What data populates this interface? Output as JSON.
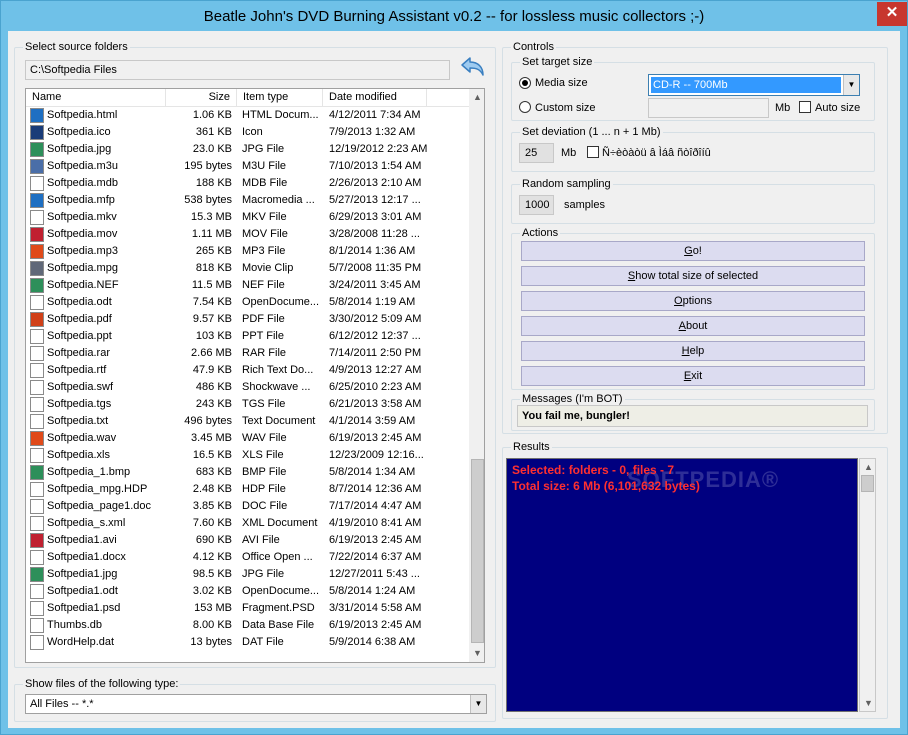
{
  "window": {
    "title": "Beatle John's DVD Burning Assistant v0.2 -- for lossless music collectors ;-)",
    "close_glyph": "✕"
  },
  "source": {
    "group_label": "Select source folders",
    "path": "C:\\Softpedia Files",
    "columns": {
      "name": "Name",
      "size": "Size",
      "type": "Item type",
      "date": "Date modified"
    },
    "files": [
      {
        "name": "Softpedia.html",
        "size": "1.06 KB",
        "type": "HTML Docum...",
        "date": "4/12/2011 7:34 AM",
        "icon": "html-icon",
        "color": "#1e6fc2"
      },
      {
        "name": "Softpedia.ico",
        "size": "361 KB",
        "type": "Icon",
        "date": "7/9/2013 1:32 AM",
        "icon": "ico-icon",
        "color": "#1a3c78"
      },
      {
        "name": "Softpedia.jpg",
        "size": "23.0 KB",
        "type": "JPG File",
        "date": "12/19/2012 2:23 AM",
        "icon": "image-icon",
        "color": "#2d8f5a"
      },
      {
        "name": "Softpedia.m3u",
        "size": "195 bytes",
        "type": "M3U File",
        "date": "7/10/2013 1:54 AM",
        "icon": "music-note-icon",
        "color": "#4a6ea8"
      },
      {
        "name": "Softpedia.mdb",
        "size": "188 KB",
        "type": "MDB File",
        "date": "2/26/2013 2:10 AM",
        "icon": "file-icon",
        "color": "#ffffff"
      },
      {
        "name": "Softpedia.mfp",
        "size": "538 bytes",
        "type": "Macromedia ...",
        "date": "5/27/2013 12:17 ...",
        "icon": "html-icon",
        "color": "#1e6fc2"
      },
      {
        "name": "Softpedia.mkv",
        "size": "15.3 MB",
        "type": "MKV File",
        "date": "6/29/2013 3:01 AM",
        "icon": "file-icon",
        "color": "#ffffff"
      },
      {
        "name": "Softpedia.mov",
        "size": "1.11 MB",
        "type": "MOV File",
        "date": "3/28/2008 11:28 ...",
        "icon": "video-icon",
        "color": "#c02030"
      },
      {
        "name": "Softpedia.mp3",
        "size": "265 KB",
        "type": "MP3 File",
        "date": "8/1/2014 1:36 AM",
        "icon": "headphones-icon",
        "color": "#e04a1a"
      },
      {
        "name": "Softpedia.mpg",
        "size": "818 KB",
        "type": "Movie Clip",
        "date": "5/7/2008 11:35 PM",
        "icon": "film-icon",
        "color": "#606878"
      },
      {
        "name": "Softpedia.NEF",
        "size": "11.5 MB",
        "type": "NEF File",
        "date": "3/24/2011 3:45 AM",
        "icon": "image-icon",
        "color": "#2d8f5a"
      },
      {
        "name": "Softpedia.odt",
        "size": "7.54 KB",
        "type": "OpenDocume...",
        "date": "5/8/2014 1:19 AM",
        "icon": "document-icon",
        "color": "#ffffff"
      },
      {
        "name": "Softpedia.pdf",
        "size": "9.57 KB",
        "type": "PDF File",
        "date": "3/30/2012 5:09 AM",
        "icon": "pdf-icon",
        "color": "#d04018"
      },
      {
        "name": "Softpedia.ppt",
        "size": "103 KB",
        "type": "PPT File",
        "date": "6/12/2012 12:37 ...",
        "icon": "file-icon",
        "color": "#ffffff"
      },
      {
        "name": "Softpedia.rar",
        "size": "2.66 MB",
        "type": "RAR File",
        "date": "7/14/2011 2:50 PM",
        "icon": "file-icon",
        "color": "#ffffff"
      },
      {
        "name": "Softpedia.rtf",
        "size": "47.9 KB",
        "type": "Rich Text Do...",
        "date": "4/9/2013 12:27 AM",
        "icon": "document-icon",
        "color": "#ffffff"
      },
      {
        "name": "Softpedia.swf",
        "size": "486 KB",
        "type": "Shockwave ...",
        "date": "6/25/2010 2:23 AM",
        "icon": "file-icon",
        "color": "#ffffff"
      },
      {
        "name": "Softpedia.tgs",
        "size": "243 KB",
        "type": "TGS File",
        "date": "6/21/2013 3:58 AM",
        "icon": "file-icon",
        "color": "#ffffff"
      },
      {
        "name": "Softpedia.txt",
        "size": "496 bytes",
        "type": "Text Document",
        "date": "4/1/2014 3:59 AM",
        "icon": "document-icon",
        "color": "#ffffff"
      },
      {
        "name": "Softpedia.wav",
        "size": "3.45 MB",
        "type": "WAV File",
        "date": "6/19/2013 2:45 AM",
        "icon": "headphones-icon",
        "color": "#e04a1a"
      },
      {
        "name": "Softpedia.xls",
        "size": "16.5 KB",
        "type": "XLS File",
        "date": "12/23/2009 12:16...",
        "icon": "file-icon",
        "color": "#ffffff"
      },
      {
        "name": "Softpedia_1.bmp",
        "size": "683 KB",
        "type": "BMP File",
        "date": "5/8/2014 1:34 AM",
        "icon": "image-icon",
        "color": "#2d8f5a"
      },
      {
        "name": "Softpedia_mpg.HDP",
        "size": "2.48 KB",
        "type": "HDP File",
        "date": "8/7/2014 12:36 AM",
        "icon": "file-icon",
        "color": "#ffffff"
      },
      {
        "name": "Softpedia_page1.doc",
        "size": "3.85 KB",
        "type": "DOC File",
        "date": "7/17/2014 4:47 AM",
        "icon": "file-icon",
        "color": "#ffffff"
      },
      {
        "name": "Softpedia_s.xml",
        "size": "7.60 KB",
        "type": "XML Document",
        "date": "4/19/2010 8:41 AM",
        "icon": "document-icon",
        "color": "#ffffff"
      },
      {
        "name": "Softpedia1.avi",
        "size": "690 KB",
        "type": "AVI File",
        "date": "6/19/2013 2:45 AM",
        "icon": "video-icon",
        "color": "#c02030"
      },
      {
        "name": "Softpedia1.docx",
        "size": "4.12 KB",
        "type": "Office Open ...",
        "date": "7/22/2014 6:37 AM",
        "icon": "document-icon",
        "color": "#ffffff"
      },
      {
        "name": "Softpedia1.jpg",
        "size": "98.5 KB",
        "type": "JPG File",
        "date": "12/27/2011 5:43 ...",
        "icon": "image-icon",
        "color": "#2d8f5a"
      },
      {
        "name": "Softpedia1.odt",
        "size": "3.02 KB",
        "type": "OpenDocume...",
        "date": "5/8/2014 1:24 AM",
        "icon": "document-icon",
        "color": "#ffffff"
      },
      {
        "name": "Softpedia1.psd",
        "size": "153 MB",
        "type": "Fragment.PSD",
        "date": "3/31/2014 5:58 AM",
        "icon": "file-icon",
        "color": "#ffffff"
      },
      {
        "name": "Thumbs.db",
        "size": "8.00 KB",
        "type": "Data Base File",
        "date": "6/19/2013 2:45 AM",
        "icon": "gear-file-icon",
        "color": "#ffffff"
      },
      {
        "name": "WordHelp.dat",
        "size": "13 bytes",
        "type": "DAT File",
        "date": "5/9/2014 6:38 AM",
        "icon": "file-icon",
        "color": "#ffffff"
      }
    ]
  },
  "filter": {
    "group_label": "Show files of the following type:",
    "value": "All Files -- *.*"
  },
  "controls": {
    "group_label": "Controls",
    "target": {
      "group_label": "Set target size",
      "media_size_label": "Media size",
      "media_size_value": "CD-R -- 700Mb",
      "custom_size_label": "Custom size",
      "custom_unit": "Mb",
      "auto_size_label": "Auto size"
    },
    "deviation": {
      "group_label": "Set deviation (1 ... n + 1 Mb)",
      "value": "25",
      "unit": "Mb",
      "checkbox_label": "Ñ÷èòàòü â Ìáâ ñòîðîíû"
    },
    "sampling": {
      "group_label": "Random sampling",
      "value": "1000",
      "unit": "samples"
    },
    "actions": {
      "group_label": "Actions",
      "buttons": [
        {
          "label": "Go!",
          "mnemonic": "G",
          "rest": "o!"
        },
        {
          "label": "Show total size of selected",
          "mnemonic": "S",
          "rest": "how total size of selected"
        },
        {
          "label": "Options",
          "mnemonic": "O",
          "rest": "ptions"
        },
        {
          "label": "About",
          "mnemonic": "A",
          "rest": "bout"
        },
        {
          "label": "Help",
          "mnemonic": "H",
          "rest": "elp"
        },
        {
          "label": "Exit",
          "mnemonic": "E",
          "rest": "xit"
        }
      ]
    },
    "messages": {
      "group_label": "Messages (I'm BOT)",
      "text": "You fail me, bungler!"
    }
  },
  "results": {
    "group_label": "Results",
    "lines": [
      "Selected: folders - 0, files - 7",
      "Total size: 6 Mb (6,101,632 bytes)"
    ],
    "watermark": "SOFTPEDIA®",
    "text_color": "#ff3030",
    "background": "#000080"
  }
}
